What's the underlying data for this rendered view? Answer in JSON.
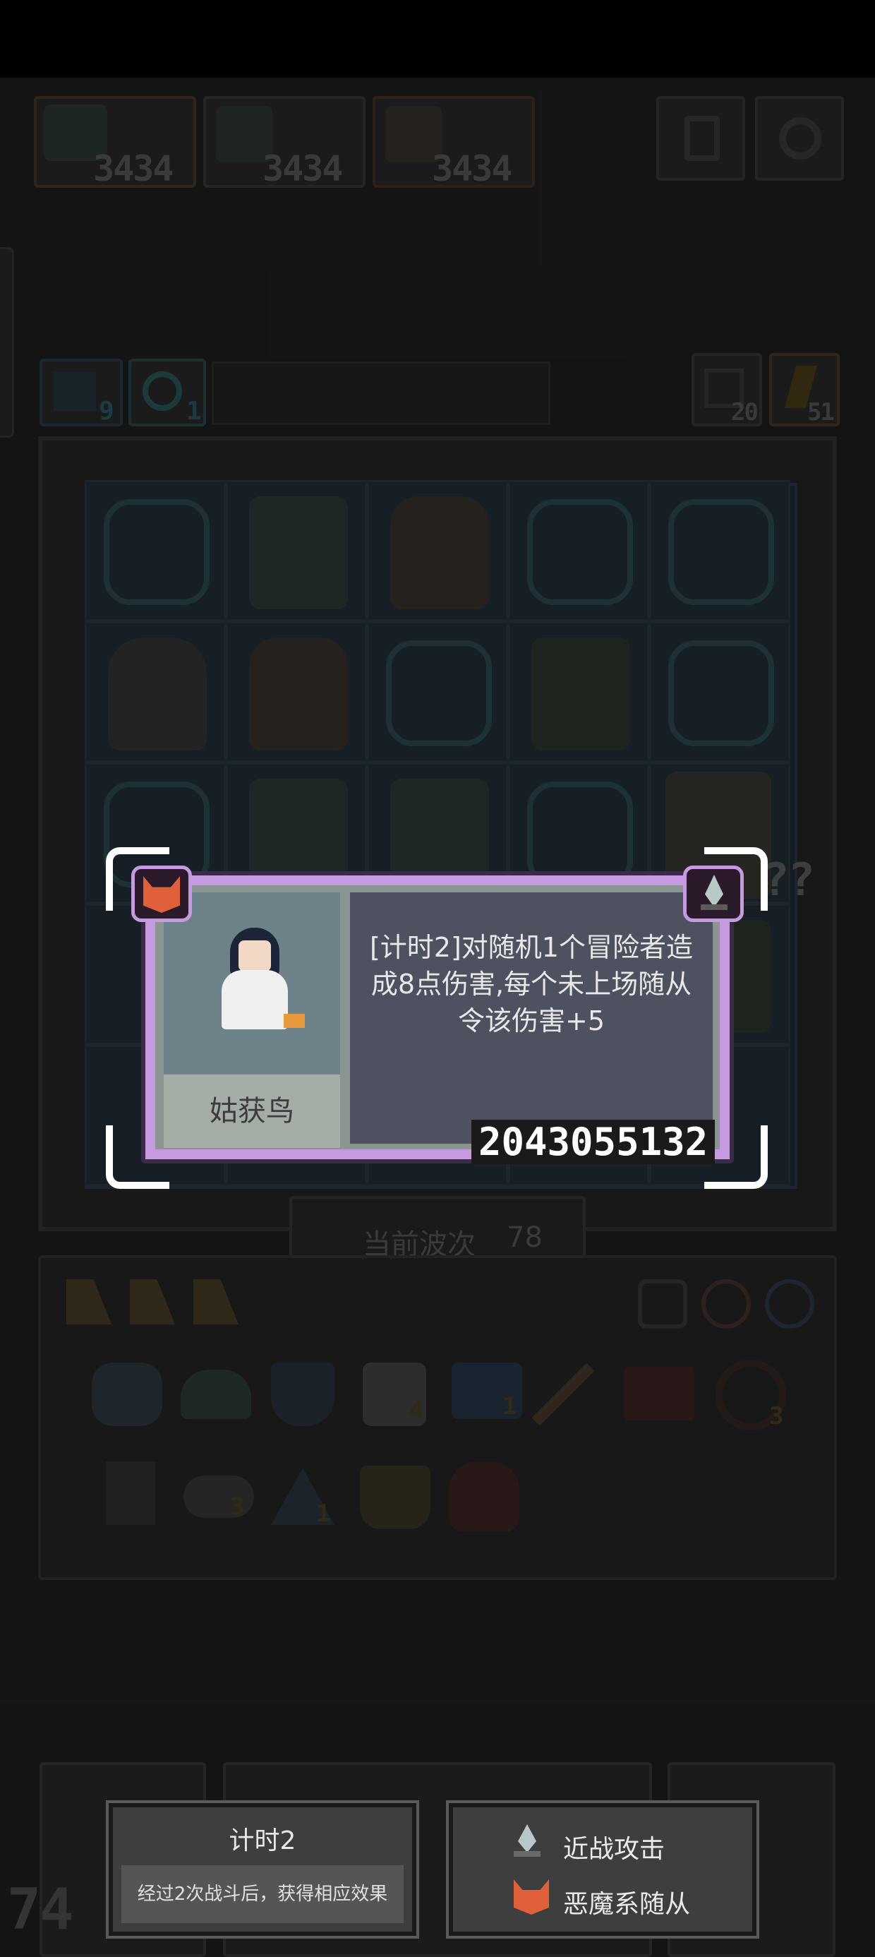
{
  "stats": [
    {
      "label": "3434",
      "icon": "beast-icon",
      "color": "#6b4a2a"
    },
    {
      "label": "3434",
      "icon": "dragon-icon",
      "color": "#4a4a4a"
    },
    {
      "label": "3434",
      "icon": "bird-icon",
      "color": "#6b3a2a"
    }
  ],
  "resources": {
    "left_a": "9",
    "left_b": "1",
    "right_a": "20",
    "right_b": "51"
  },
  "wave": {
    "label": "当前波次",
    "number": "78"
  },
  "inventory": {
    "item_counts": [
      "4",
      "1",
      "3",
      "3",
      "1"
    ]
  },
  "card": {
    "name": "姑获鸟",
    "description": "[计时2]对随机1个冒险者造成8点伤害,每个未上场随从令该伤害+5",
    "code": "2043055132",
    "frame_color": "#c69ae0"
  },
  "tooltip_left": {
    "title": "计时2",
    "subtitle": "经过2次战斗后，获得相应效果"
  },
  "tooltip_right": {
    "tags": [
      {
        "icon": "sword-icon",
        "label": "近战攻击"
      },
      {
        "icon": "demon-icon",
        "label": "恶魔系随从"
      }
    ]
  },
  "bottom_left_number": "74",
  "unknown_marker": "??"
}
